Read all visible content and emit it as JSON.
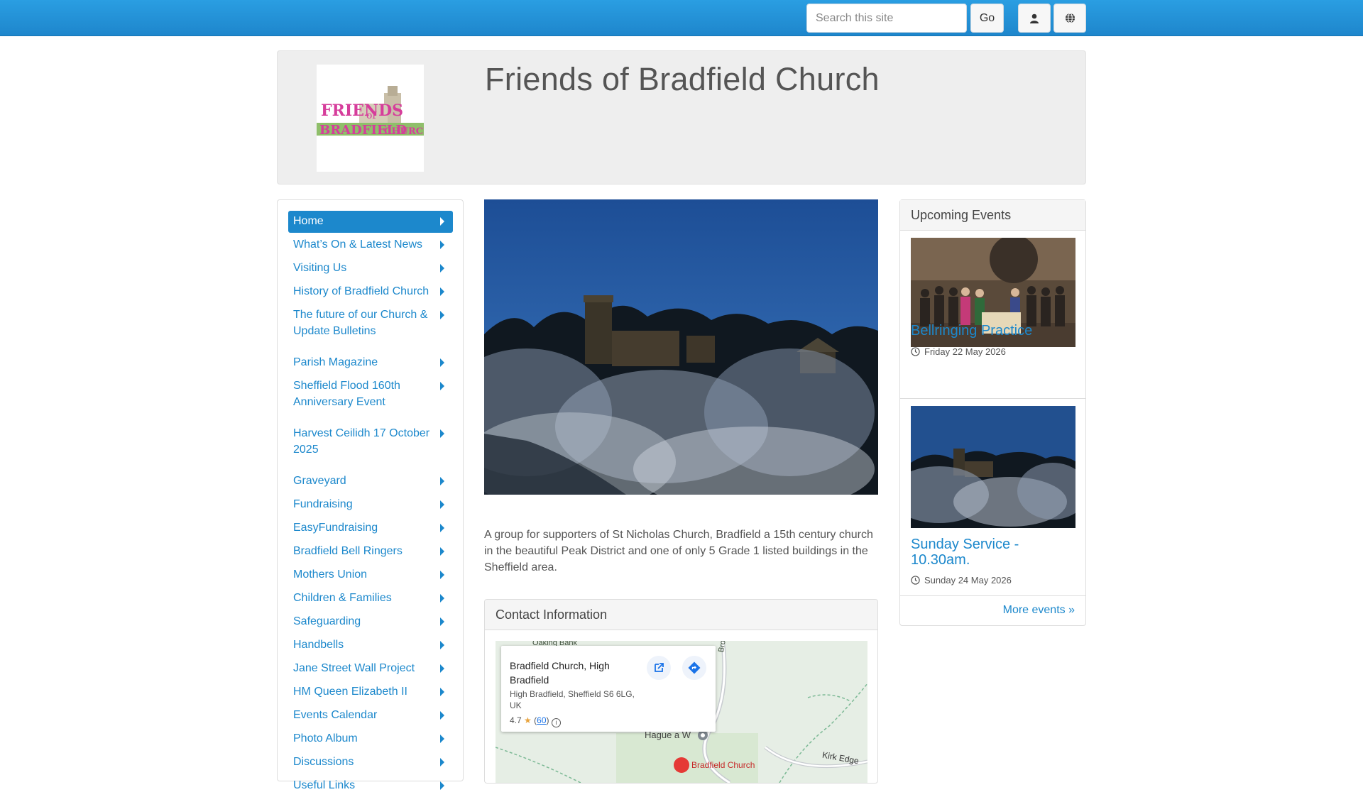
{
  "topbar": {
    "search_placeholder": "Search this site",
    "go_label": "Go",
    "icons": [
      "user-icon",
      "globe-icon"
    ],
    "color": "#2a9ee2"
  },
  "header": {
    "site_title": "Friends of Bradfield Church"
  },
  "sidebar": {
    "items": [
      {
        "label": "Home",
        "active": true
      },
      {
        "label": "What’s On & Latest News"
      },
      {
        "label": "Visiting Us"
      },
      {
        "label": "History of Bradfield Church"
      },
      {
        "label": "The future of our Church & Update Bulletins"
      },
      {
        "label": "Parish Magazine"
      },
      {
        "label": "Sheffield Flood 160th Anniversary Event"
      },
      {
        "label": "Harvest Ceilidh 17 October 2025"
      },
      {
        "label": "Graveyard"
      },
      {
        "label": "Fundraising"
      },
      {
        "label": "EasyFundraising"
      },
      {
        "label": "Bradfield Bell Ringers"
      },
      {
        "label": "Mothers Union"
      },
      {
        "label": "Children & Families"
      },
      {
        "label": "Safeguarding"
      },
      {
        "label": "Handbells"
      },
      {
        "label": "Jane Street Wall Project"
      },
      {
        "label": "HM Queen Elizabeth II"
      },
      {
        "label": "Events Calendar"
      },
      {
        "label": "Photo Album"
      },
      {
        "label": "Discussions"
      },
      {
        "label": "Useful Links"
      }
    ]
  },
  "main": {
    "intro": "A group for supporters of St Nicholas Church, Bradfield a 15th century church in the beautiful Peak District and one of only 5 Grade 1 listed buildings in the Sheffield area.",
    "contact": {
      "heading": "Contact Information",
      "map": {
        "place": "Bradfield Church, High Bradfield",
        "address": "High Bradfield, Sheffield S6 6LG, UK",
        "rating": "4.7",
        "review_count": "60",
        "labels": {
          "oaking": "Oaking Bank",
          "brown": "Brown H",
          "hague": "Hague a W",
          "kirk": "Kirk Edge",
          "church": "Bradfield Church"
        }
      }
    }
  },
  "events": {
    "heading": "Upcoming Events",
    "items": [
      {
        "title": "Bellringing Practice",
        "date": "Friday 22 May 2026"
      },
      {
        "title": "Sunday Service - 10.30am.",
        "date": "Sunday 24 May 2026"
      }
    ],
    "more": "More events »"
  },
  "colors": {
    "link": "#1c88cc",
    "panel_bg": "#eeeeee"
  }
}
